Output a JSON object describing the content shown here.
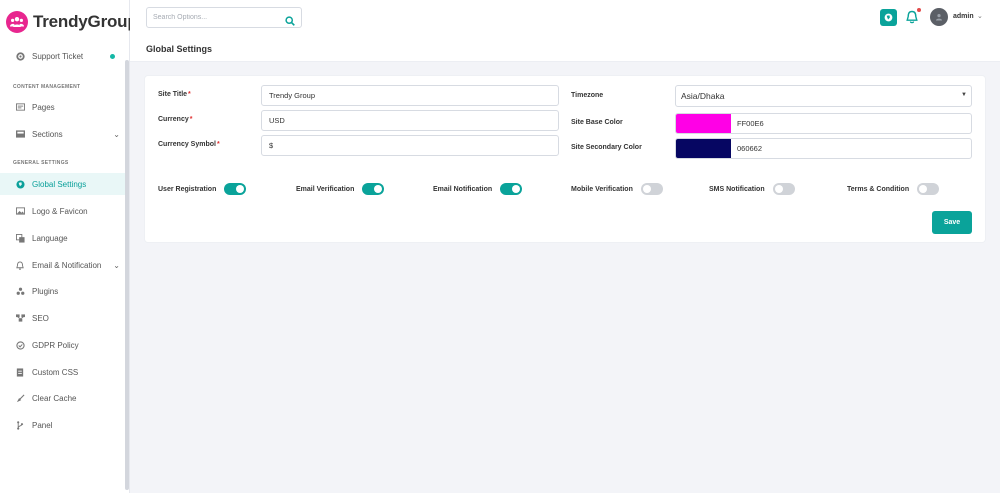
{
  "app": {
    "logo_text": "TrendyGroup"
  },
  "search": {
    "placeholder": "Search Options..."
  },
  "header": {
    "page_title": "Global Settings",
    "user_name": "admin",
    "notification_dot_color": "#e24b4b"
  },
  "sidebar": {
    "support": {
      "label": "Support Ticket"
    },
    "section_content": "CONTENT MANAGEMENT",
    "content_items": [
      {
        "label": "Pages"
      },
      {
        "label": "Sections"
      }
    ],
    "section_general": "GENERAL SETTINGS",
    "general_items": [
      {
        "label": "Global Settings"
      },
      {
        "label": "Logo & Favicon"
      },
      {
        "label": "Language"
      },
      {
        "label": "Email & Notification"
      },
      {
        "label": "Plugins"
      },
      {
        "label": "SEO"
      },
      {
        "label": "GDPR Policy"
      },
      {
        "label": "Custom CSS"
      },
      {
        "label": "Clear Cache"
      },
      {
        "label": "Panel"
      }
    ]
  },
  "form": {
    "site_title": {
      "label": "Site Title",
      "required_mark": "*",
      "value": "Trendy Group"
    },
    "currency": {
      "label": "Currency",
      "required_mark": "*",
      "value": "USD"
    },
    "currency_symbol": {
      "label": "Currency Symbol",
      "required_mark": "*",
      "value": "$"
    },
    "timezone": {
      "label": "Timezone",
      "value": "Asia/Dhaka"
    },
    "base_color": {
      "label": "Site Base Color",
      "value": "FF00E6",
      "hex": "#ff00e6"
    },
    "secondary_color": {
      "label": "Site Secondary Color",
      "value": "060662",
      "hex": "#060662"
    },
    "toggles": [
      {
        "label": "User Registration",
        "on": true
      },
      {
        "label": "Email Verification",
        "on": true
      },
      {
        "label": "Email Notification",
        "on": true
      },
      {
        "label": "Mobile Verification",
        "on": false
      },
      {
        "label": "SMS Notification",
        "on": false
      },
      {
        "label": "Terms & Condition",
        "on": false
      }
    ],
    "save_label": "Save"
  },
  "colors": {
    "accent": "#0aa39a",
    "brand": "#e8268f"
  }
}
